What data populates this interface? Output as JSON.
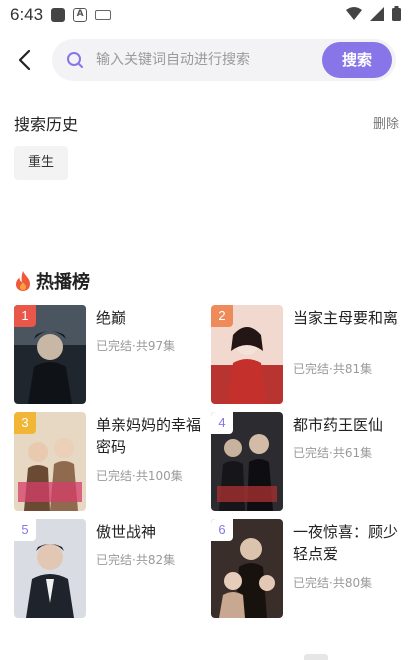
{
  "status_bar": {
    "time": "6:43"
  },
  "search": {
    "placeholder": "输入关键词自动进行搜索",
    "button_label": "搜索"
  },
  "history": {
    "title": "搜索历史",
    "delete_label": "删除",
    "items": [
      "重生"
    ]
  },
  "hot": {
    "title": "热播榜",
    "items": [
      {
        "rank": "1",
        "title": "绝巅",
        "meta": "已完结·共97集",
        "rank_color": "#e8574a",
        "cover_colors": [
          "#2f3a44",
          "#6b6b6b",
          "#1a1d22"
        ]
      },
      {
        "rank": "2",
        "title": "当家主母要和离",
        "meta": "已完结·共81集",
        "rank_color": "#ef8a5a",
        "cover_colors": [
          "#c9403c",
          "#f3d6c8",
          "#8a1c1c"
        ]
      },
      {
        "rank": "3",
        "title": "单亲妈妈的幸福密码",
        "meta": "已完结·共100集",
        "rank_color": "#f2b637",
        "cover_colors": [
          "#d8c7a8",
          "#b58a63",
          "#6b4a34"
        ]
      },
      {
        "rank": "4",
        "title": "都市药王医仙",
        "meta": "已完结·共61集",
        "rank_color": "#ffffff",
        "cover_colors": [
          "#2a2a2e",
          "#8a8a90",
          "#111114"
        ]
      },
      {
        "rank": "5",
        "title": "傲世战神",
        "meta": "已完结·共82集",
        "rank_color": "#ffffff",
        "cover_colors": [
          "#cfd3da",
          "#707784",
          "#2a2f3a"
        ]
      },
      {
        "rank": "6",
        "title": "一夜惊喜：顾少轻点爱",
        "meta": "已完结·共80集",
        "rank_color": "#ffffff",
        "cover_colors": [
          "#3a2e2a",
          "#b39a86",
          "#1c1412"
        ]
      }
    ]
  },
  "colors": {
    "accent": "#8875e8",
    "rank_text_top": "#ffffff",
    "rank_text_other": "#8875e8"
  }
}
